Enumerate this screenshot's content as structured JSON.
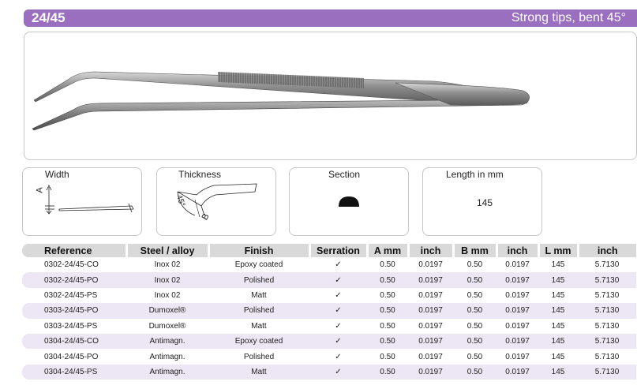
{
  "header": {
    "code": "24/45",
    "description": "Strong tips, bent 45°"
  },
  "specs": {
    "width": {
      "title": "Width",
      "letter": "A"
    },
    "thickness": {
      "title": "Thickness",
      "angle": "45°",
      "letter": "B"
    },
    "section": {
      "title": "Section"
    },
    "length": {
      "title": "Length in mm",
      "value": "145"
    }
  },
  "table": {
    "headers": [
      "Reference",
      "Steel / alloy",
      "Finish",
      "Serration",
      "A mm",
      "inch",
      "B mm",
      "inch",
      "L mm",
      "inch"
    ],
    "rows": [
      [
        "0302-24/45-CO",
        "Inox 02",
        "Epoxy coated",
        "✓",
        "0.50",
        "0.0197",
        "0.50",
        "0.0197",
        "145",
        "5.7130"
      ],
      [
        "0302-24/45-PO",
        "Inox 02",
        "Polished",
        "✓",
        "0.50",
        "0.0197",
        "0.50",
        "0.0197",
        "145",
        "5.7130"
      ],
      [
        "0302-24/45-PS",
        "Inox 02",
        "Matt",
        "✓",
        "0.50",
        "0.0197",
        "0.50",
        "0.0197",
        "145",
        "5.7130"
      ],
      [
        "0303-24/45-PO",
        "Dumoxel®",
        "Polished",
        "✓",
        "0.50",
        "0.0197",
        "0.50",
        "0.0197",
        "145",
        "5.7130"
      ],
      [
        "0303-24/45-PS",
        "Dumoxel®",
        "Matt",
        "✓",
        "0.50",
        "0.0197",
        "0.50",
        "0.0197",
        "145",
        "5.7130"
      ],
      [
        "0304-24/45-CO",
        "Antimagn.",
        "Epoxy coated",
        "✓",
        "0.50",
        "0.0197",
        "0.50",
        "0.0197",
        "145",
        "5.7130"
      ],
      [
        "0304-24/45-PO",
        "Antimagn.",
        "Polished",
        "✓",
        "0.50",
        "0.0197",
        "0.50",
        "0.0197",
        "145",
        "5.7130"
      ],
      [
        "0304-24/45-PS",
        "Antimagn.",
        "Matt",
        "✓",
        "0.50",
        "0.0197",
        "0.50",
        "0.0197",
        "145",
        "5.7130"
      ]
    ]
  },
  "colors": {
    "accent": "#9b6fc0",
    "row_alt": "#ede6f4",
    "header_bg": "#d9d9d9"
  }
}
